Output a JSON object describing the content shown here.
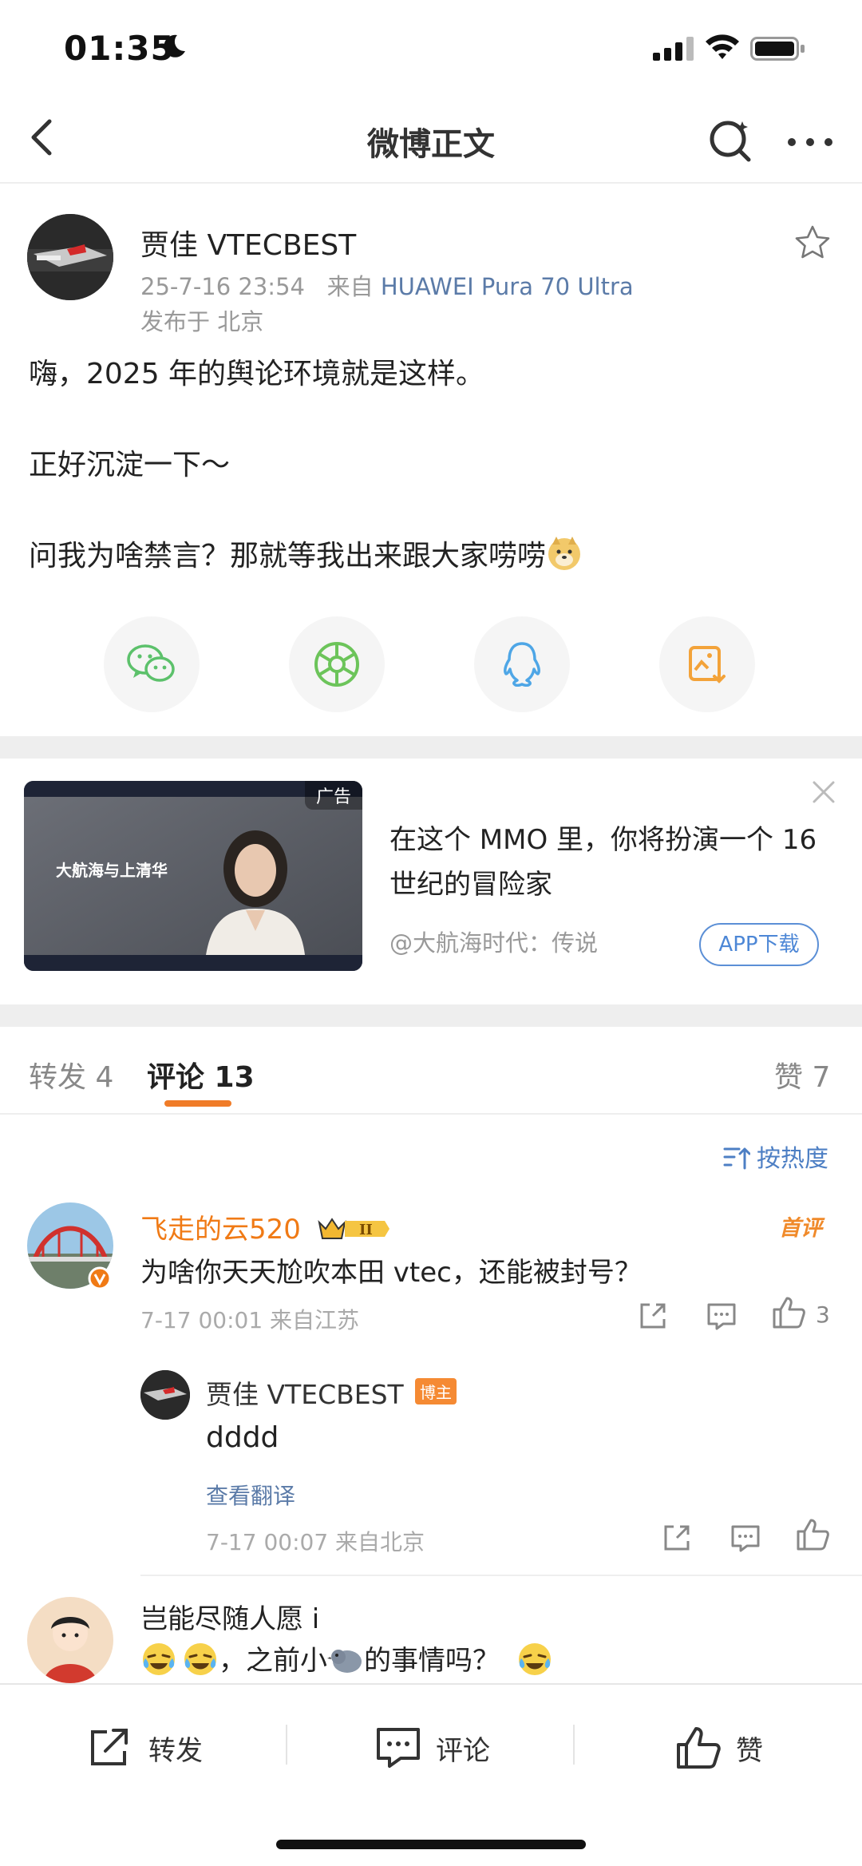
{
  "status_bar": {
    "time": "01:35"
  },
  "nav": {
    "title": "微博正文"
  },
  "post": {
    "author": "贾佳 VTECBEST",
    "time": "25-7-16 23:54",
    "from_prefix": "来自",
    "source": "HUAWEI Pura 70 Ultra",
    "location": "发布于 北京",
    "lines": [
      "嗨，2025 年的舆论环境就是这样。",
      "正好沉淀一下～",
      "问我为啥禁言？那就等我出来跟大家唠唠"
    ]
  },
  "share": [
    "wechat-icon",
    "moments-icon",
    "qq-icon",
    "save-image-icon"
  ],
  "ad": {
    "tag": "广告",
    "title": "在这个 MMO 里，你将扮演一个 16 世纪的冒险家",
    "source": "@大航海时代：传说",
    "button": "APP下载",
    "image_caption": "大航海与上清华"
  },
  "tabs": [
    {
      "label": "转发 4"
    },
    {
      "label": "评论 13"
    },
    {
      "label": "赞 7"
    }
  ],
  "sort": {
    "label": "按热度"
  },
  "comments": [
    {
      "name": "飞走的云520",
      "badge": "首评",
      "text": "为啥你天天尬吹本田 vtec，还能被封号？",
      "meta": "7-17 00:01 来自江苏",
      "likes": "3",
      "reply": {
        "name": "贾佳 VTECBEST",
        "tag": "博主",
        "text": "dddd",
        "translate": "查看翻译",
        "meta": "7-17 00:07 来自北京"
      }
    },
    {
      "name": "岂能尽随人愿 i",
      "text": "，之前小",
      "text_tail": "的事情吗？"
    }
  ],
  "bottom_bar": {
    "repost": "转发",
    "comment": "评论",
    "like": "赞"
  },
  "colors": {
    "accent": "#f07c28",
    "link": "#5b7ba8",
    "vip_name": "#f07a15"
  }
}
